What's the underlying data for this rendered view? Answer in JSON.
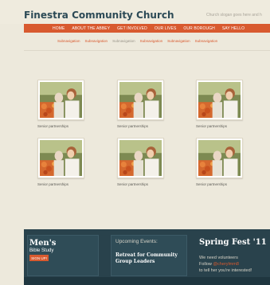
{
  "site": {
    "title": "Finestra Community Church",
    "slogan": "Church slogan goes here and h"
  },
  "main_nav": [
    {
      "label": "HOME"
    },
    {
      "label": "ABOUT THE ABBEY"
    },
    {
      "label": "GET INVOLVED"
    },
    {
      "label": "OUR LIVES"
    },
    {
      "label": "OUR BOROUGH"
    },
    {
      "label": "SAY HELLO"
    }
  ],
  "sub_nav": [
    {
      "label": "Subnavigation",
      "active": true
    },
    {
      "label": "Subnavigation",
      "active": true
    },
    {
      "label": "Subnavigation",
      "active": false
    },
    {
      "label": "Subnavigation",
      "active": true
    },
    {
      "label": "Subnavigation",
      "active": true
    },
    {
      "label": "Subnavigation",
      "active": true
    }
  ],
  "gallery": [
    {
      "caption": "Senior partnerships"
    },
    {
      "caption": "Senior partnerships"
    },
    {
      "caption": "Senior partnerships"
    },
    {
      "caption": "Senior partnerships"
    },
    {
      "caption": "Senior partnerships"
    },
    {
      "caption": "Senior partnerships"
    }
  ],
  "footer": {
    "mens": {
      "title": "Men's",
      "subtitle": "Bible Study",
      "button": "SIGN UP!"
    },
    "events": {
      "heading": "Upcoming Events:",
      "item": "Retreat for Community Group Leaders"
    },
    "fest": {
      "title": "Spring Fest '11",
      "line1": "We need volunteers",
      "line2_prefix": "Follow ",
      "line2_handle": "@cherylmm8",
      "line3": "to tell her you're interested!"
    }
  },
  "colors": {
    "accent": "#d85a2f",
    "title": "#2c4a56",
    "footer": "#29424c",
    "background": "#ede9dc"
  }
}
